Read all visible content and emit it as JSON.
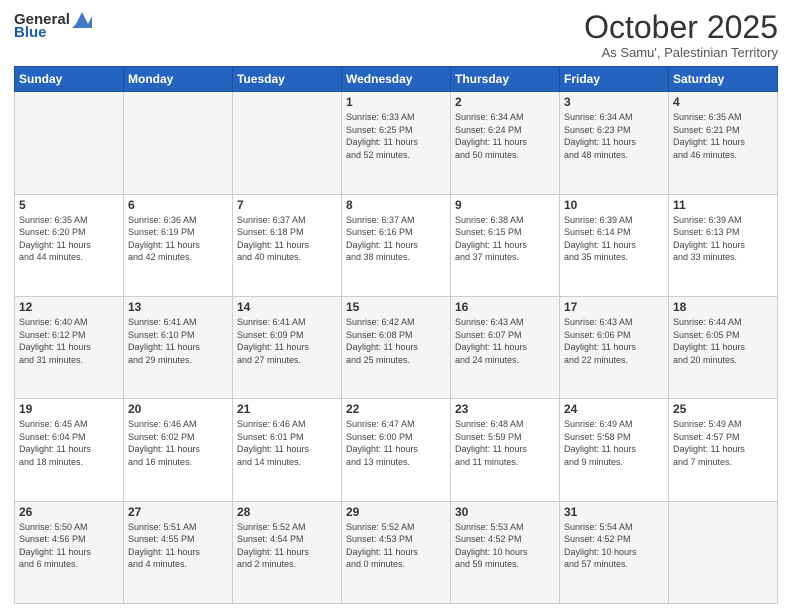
{
  "logo": {
    "general": "General",
    "blue": "Blue"
  },
  "header": {
    "month": "October 2025",
    "location": "As Samu', Palestinian Territory"
  },
  "weekdays": [
    "Sunday",
    "Monday",
    "Tuesday",
    "Wednesday",
    "Thursday",
    "Friday",
    "Saturday"
  ],
  "weeks": [
    [
      {
        "day": "",
        "info": ""
      },
      {
        "day": "",
        "info": ""
      },
      {
        "day": "",
        "info": ""
      },
      {
        "day": "1",
        "info": "Sunrise: 6:33 AM\nSunset: 6:25 PM\nDaylight: 11 hours\nand 52 minutes."
      },
      {
        "day": "2",
        "info": "Sunrise: 6:34 AM\nSunset: 6:24 PM\nDaylight: 11 hours\nand 50 minutes."
      },
      {
        "day": "3",
        "info": "Sunrise: 6:34 AM\nSunset: 6:23 PM\nDaylight: 11 hours\nand 48 minutes."
      },
      {
        "day": "4",
        "info": "Sunrise: 6:35 AM\nSunset: 6:21 PM\nDaylight: 11 hours\nand 46 minutes."
      }
    ],
    [
      {
        "day": "5",
        "info": "Sunrise: 6:35 AM\nSunset: 6:20 PM\nDaylight: 11 hours\nand 44 minutes."
      },
      {
        "day": "6",
        "info": "Sunrise: 6:36 AM\nSunset: 6:19 PM\nDaylight: 11 hours\nand 42 minutes."
      },
      {
        "day": "7",
        "info": "Sunrise: 6:37 AM\nSunset: 6:18 PM\nDaylight: 11 hours\nand 40 minutes."
      },
      {
        "day": "8",
        "info": "Sunrise: 6:37 AM\nSunset: 6:16 PM\nDaylight: 11 hours\nand 38 minutes."
      },
      {
        "day": "9",
        "info": "Sunrise: 6:38 AM\nSunset: 6:15 PM\nDaylight: 11 hours\nand 37 minutes."
      },
      {
        "day": "10",
        "info": "Sunrise: 6:39 AM\nSunset: 6:14 PM\nDaylight: 11 hours\nand 35 minutes."
      },
      {
        "day": "11",
        "info": "Sunrise: 6:39 AM\nSunset: 6:13 PM\nDaylight: 11 hours\nand 33 minutes."
      }
    ],
    [
      {
        "day": "12",
        "info": "Sunrise: 6:40 AM\nSunset: 6:12 PM\nDaylight: 11 hours\nand 31 minutes."
      },
      {
        "day": "13",
        "info": "Sunrise: 6:41 AM\nSunset: 6:10 PM\nDaylight: 11 hours\nand 29 minutes."
      },
      {
        "day": "14",
        "info": "Sunrise: 6:41 AM\nSunset: 6:09 PM\nDaylight: 11 hours\nand 27 minutes."
      },
      {
        "day": "15",
        "info": "Sunrise: 6:42 AM\nSunset: 6:08 PM\nDaylight: 11 hours\nand 25 minutes."
      },
      {
        "day": "16",
        "info": "Sunrise: 6:43 AM\nSunset: 6:07 PM\nDaylight: 11 hours\nand 24 minutes."
      },
      {
        "day": "17",
        "info": "Sunrise: 6:43 AM\nSunset: 6:06 PM\nDaylight: 11 hours\nand 22 minutes."
      },
      {
        "day": "18",
        "info": "Sunrise: 6:44 AM\nSunset: 6:05 PM\nDaylight: 11 hours\nand 20 minutes."
      }
    ],
    [
      {
        "day": "19",
        "info": "Sunrise: 6:45 AM\nSunset: 6:04 PM\nDaylight: 11 hours\nand 18 minutes."
      },
      {
        "day": "20",
        "info": "Sunrise: 6:46 AM\nSunset: 6:02 PM\nDaylight: 11 hours\nand 16 minutes."
      },
      {
        "day": "21",
        "info": "Sunrise: 6:46 AM\nSunset: 6:01 PM\nDaylight: 11 hours\nand 14 minutes."
      },
      {
        "day": "22",
        "info": "Sunrise: 6:47 AM\nSunset: 6:00 PM\nDaylight: 11 hours\nand 13 minutes."
      },
      {
        "day": "23",
        "info": "Sunrise: 6:48 AM\nSunset: 5:59 PM\nDaylight: 11 hours\nand 11 minutes."
      },
      {
        "day": "24",
        "info": "Sunrise: 6:49 AM\nSunset: 5:58 PM\nDaylight: 11 hours\nand 9 minutes."
      },
      {
        "day": "25",
        "info": "Sunrise: 5:49 AM\nSunset: 4:57 PM\nDaylight: 11 hours\nand 7 minutes."
      }
    ],
    [
      {
        "day": "26",
        "info": "Sunrise: 5:50 AM\nSunset: 4:56 PM\nDaylight: 11 hours\nand 6 minutes."
      },
      {
        "day": "27",
        "info": "Sunrise: 5:51 AM\nSunset: 4:55 PM\nDaylight: 11 hours\nand 4 minutes."
      },
      {
        "day": "28",
        "info": "Sunrise: 5:52 AM\nSunset: 4:54 PM\nDaylight: 11 hours\nand 2 minutes."
      },
      {
        "day": "29",
        "info": "Sunrise: 5:52 AM\nSunset: 4:53 PM\nDaylight: 11 hours\nand 0 minutes."
      },
      {
        "day": "30",
        "info": "Sunrise: 5:53 AM\nSunset: 4:52 PM\nDaylight: 10 hours\nand 59 minutes."
      },
      {
        "day": "31",
        "info": "Sunrise: 5:54 AM\nSunset: 4:52 PM\nDaylight: 10 hours\nand 57 minutes."
      },
      {
        "day": "",
        "info": ""
      }
    ]
  ]
}
